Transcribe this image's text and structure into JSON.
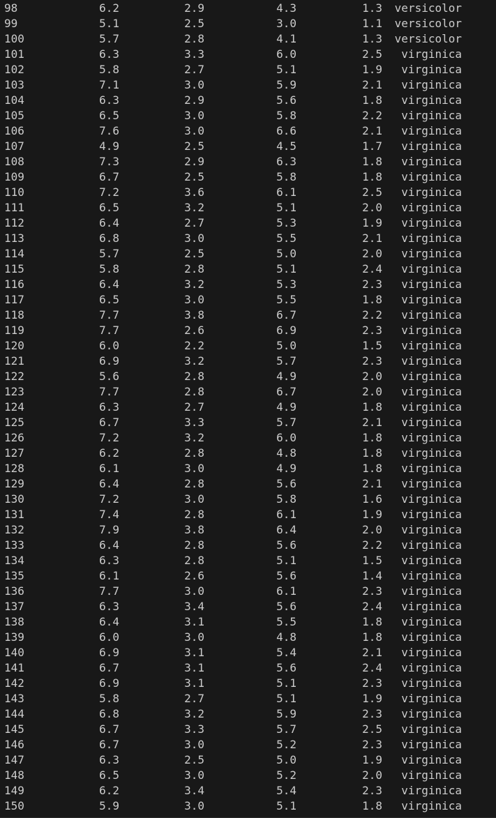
{
  "colors": {
    "background": "#181818",
    "text": "#cccccc"
  },
  "rows": [
    [
      "98",
      "6.2",
      "2.9",
      "4.3",
      "1.3",
      "versicolor"
    ],
    [
      "99",
      "5.1",
      "2.5",
      "3.0",
      "1.1",
      "versicolor"
    ],
    [
      "100",
      "5.7",
      "2.8",
      "4.1",
      "1.3",
      "versicolor"
    ],
    [
      "101",
      "6.3",
      "3.3",
      "6.0",
      "2.5",
      "virginica"
    ],
    [
      "102",
      "5.8",
      "2.7",
      "5.1",
      "1.9",
      "virginica"
    ],
    [
      "103",
      "7.1",
      "3.0",
      "5.9",
      "2.1",
      "virginica"
    ],
    [
      "104",
      "6.3",
      "2.9",
      "5.6",
      "1.8",
      "virginica"
    ],
    [
      "105",
      "6.5",
      "3.0",
      "5.8",
      "2.2",
      "virginica"
    ],
    [
      "106",
      "7.6",
      "3.0",
      "6.6",
      "2.1",
      "virginica"
    ],
    [
      "107",
      "4.9",
      "2.5",
      "4.5",
      "1.7",
      "virginica"
    ],
    [
      "108",
      "7.3",
      "2.9",
      "6.3",
      "1.8",
      "virginica"
    ],
    [
      "109",
      "6.7",
      "2.5",
      "5.8",
      "1.8",
      "virginica"
    ],
    [
      "110",
      "7.2",
      "3.6",
      "6.1",
      "2.5",
      "virginica"
    ],
    [
      "111",
      "6.5",
      "3.2",
      "5.1",
      "2.0",
      "virginica"
    ],
    [
      "112",
      "6.4",
      "2.7",
      "5.3",
      "1.9",
      "virginica"
    ],
    [
      "113",
      "6.8",
      "3.0",
      "5.5",
      "2.1",
      "virginica"
    ],
    [
      "114",
      "5.7",
      "2.5",
      "5.0",
      "2.0",
      "virginica"
    ],
    [
      "115",
      "5.8",
      "2.8",
      "5.1",
      "2.4",
      "virginica"
    ],
    [
      "116",
      "6.4",
      "3.2",
      "5.3",
      "2.3",
      "virginica"
    ],
    [
      "117",
      "6.5",
      "3.0",
      "5.5",
      "1.8",
      "virginica"
    ],
    [
      "118",
      "7.7",
      "3.8",
      "6.7",
      "2.2",
      "virginica"
    ],
    [
      "119",
      "7.7",
      "2.6",
      "6.9",
      "2.3",
      "virginica"
    ],
    [
      "120",
      "6.0",
      "2.2",
      "5.0",
      "1.5",
      "virginica"
    ],
    [
      "121",
      "6.9",
      "3.2",
      "5.7",
      "2.3",
      "virginica"
    ],
    [
      "122",
      "5.6",
      "2.8",
      "4.9",
      "2.0",
      "virginica"
    ],
    [
      "123",
      "7.7",
      "2.8",
      "6.7",
      "2.0",
      "virginica"
    ],
    [
      "124",
      "6.3",
      "2.7",
      "4.9",
      "1.8",
      "virginica"
    ],
    [
      "125",
      "6.7",
      "3.3",
      "5.7",
      "2.1",
      "virginica"
    ],
    [
      "126",
      "7.2",
      "3.2",
      "6.0",
      "1.8",
      "virginica"
    ],
    [
      "127",
      "6.2",
      "2.8",
      "4.8",
      "1.8",
      "virginica"
    ],
    [
      "128",
      "6.1",
      "3.0",
      "4.9",
      "1.8",
      "virginica"
    ],
    [
      "129",
      "6.4",
      "2.8",
      "5.6",
      "2.1",
      "virginica"
    ],
    [
      "130",
      "7.2",
      "3.0",
      "5.8",
      "1.6",
      "virginica"
    ],
    [
      "131",
      "7.4",
      "2.8",
      "6.1",
      "1.9",
      "virginica"
    ],
    [
      "132",
      "7.9",
      "3.8",
      "6.4",
      "2.0",
      "virginica"
    ],
    [
      "133",
      "6.4",
      "2.8",
      "5.6",
      "2.2",
      "virginica"
    ],
    [
      "134",
      "6.3",
      "2.8",
      "5.1",
      "1.5",
      "virginica"
    ],
    [
      "135",
      "6.1",
      "2.6",
      "5.6",
      "1.4",
      "virginica"
    ],
    [
      "136",
      "7.7",
      "3.0",
      "6.1",
      "2.3",
      "virginica"
    ],
    [
      "137",
      "6.3",
      "3.4",
      "5.6",
      "2.4",
      "virginica"
    ],
    [
      "138",
      "6.4",
      "3.1",
      "5.5",
      "1.8",
      "virginica"
    ],
    [
      "139",
      "6.0",
      "3.0",
      "4.8",
      "1.8",
      "virginica"
    ],
    [
      "140",
      "6.9",
      "3.1",
      "5.4",
      "2.1",
      "virginica"
    ],
    [
      "141",
      "6.7",
      "3.1",
      "5.6",
      "2.4",
      "virginica"
    ],
    [
      "142",
      "6.9",
      "3.1",
      "5.1",
      "2.3",
      "virginica"
    ],
    [
      "143",
      "5.8",
      "2.7",
      "5.1",
      "1.9",
      "virginica"
    ],
    [
      "144",
      "6.8",
      "3.2",
      "5.9",
      "2.3",
      "virginica"
    ],
    [
      "145",
      "6.7",
      "3.3",
      "5.7",
      "2.5",
      "virginica"
    ],
    [
      "146",
      "6.7",
      "3.0",
      "5.2",
      "2.3",
      "virginica"
    ],
    [
      "147",
      "6.3",
      "2.5",
      "5.0",
      "1.9",
      "virginica"
    ],
    [
      "148",
      "6.5",
      "3.0",
      "5.2",
      "2.0",
      "virginica"
    ],
    [
      "149",
      "6.2",
      "3.4",
      "5.4",
      "2.3",
      "virginica"
    ],
    [
      "150",
      "5.9",
      "3.0",
      "5.1",
      "1.8",
      "virginica"
    ]
  ]
}
